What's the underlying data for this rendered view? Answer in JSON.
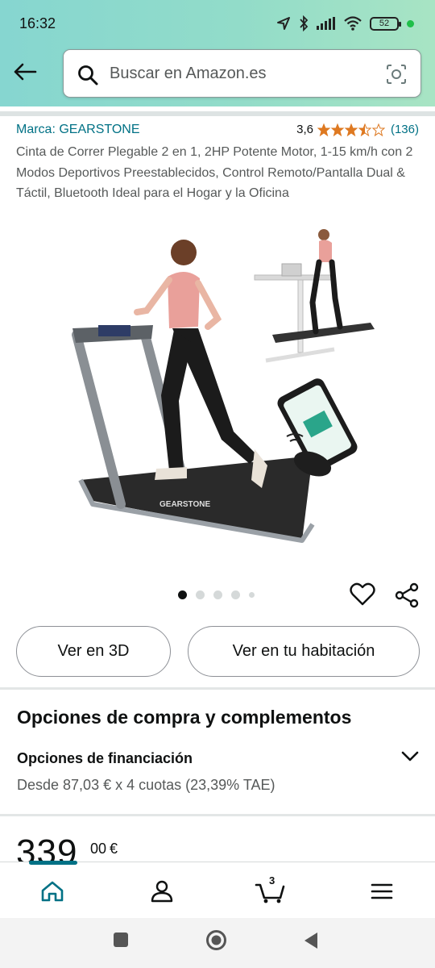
{
  "status_bar": {
    "time": "16:32",
    "battery": "52"
  },
  "search": {
    "placeholder": "Buscar en Amazon.es"
  },
  "product": {
    "brand": "Marca: GEARSTONE",
    "rating_value": "3,6",
    "rating_stars": 3.5,
    "rating_count": "(136)",
    "title": "Cinta de Correr Plegable 2 en 1, 2HP Potente Motor, 1-15 km/h con 2 Modos Deportivos Preestablecidos, Control Remoto/Pantalla Dual & Táctil, Bluetooth Ideal para el Hogar y la Oficina",
    "image_brand_label": "GEARSTONE",
    "image_count": 5,
    "image_index": 1
  },
  "actions": {
    "view_3d": "Ver en 3D",
    "view_room": "Ver en tu habitación"
  },
  "purchase_options": {
    "section_title": "Opciones de compra y complementos",
    "financing_title": "Opciones de financiación",
    "financing_detail": "Desde 87,03 € x 4 cuotas (23,39% TAE)"
  },
  "price": {
    "whole": "339",
    "fraction": "00",
    "currency": "€"
  },
  "nav": {
    "cart_count": "3",
    "items": [
      "home-icon",
      "user-icon",
      "cart-icon",
      "menu-icon"
    ]
  },
  "colors": {
    "header_start": "#86d6d0",
    "header_end": "#a8e4c4",
    "link": "#007185",
    "star": "#de7921"
  }
}
